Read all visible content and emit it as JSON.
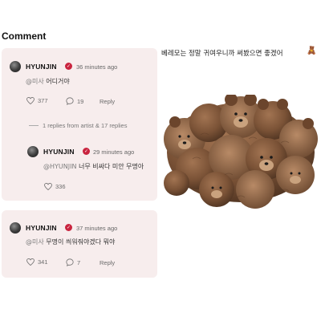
{
  "comments_section": {
    "title": "Comment",
    "thread": {
      "comment": {
        "username": "HYUNJIN",
        "timestamp": "36 minutes ago",
        "mention": "@미사",
        "text": "어디거야",
        "likes": "377",
        "replies": "19",
        "reply_label": "Reply"
      },
      "replies_summary": "1 replies from artist & 17 replies",
      "reply": {
        "username": "HYUNJIN",
        "timestamp": "29 minutes ago",
        "mention": "@HYUNJIN",
        "text": "너무 비싸다 미안 무명아",
        "likes": "336"
      }
    },
    "second_comment": {
      "username": "HYUNJIN",
      "timestamp": "37 minutes ago",
      "mention": "@미사",
      "text": "무명이 씌워줘야겠다 뭐야",
      "likes": "341",
      "replies": "7",
      "reply_label": "Reply"
    }
  },
  "post": {
    "caption": "베레모는 정말 귀여우니까 써봤으면 좋겠어",
    "caption_emoji": "🧸",
    "image_subject": "teddy-bear-cluster"
  },
  "colors": {
    "card_background": "#f7eded",
    "verified_badge": "#c9243f",
    "bear_brown": "#7a5236"
  }
}
